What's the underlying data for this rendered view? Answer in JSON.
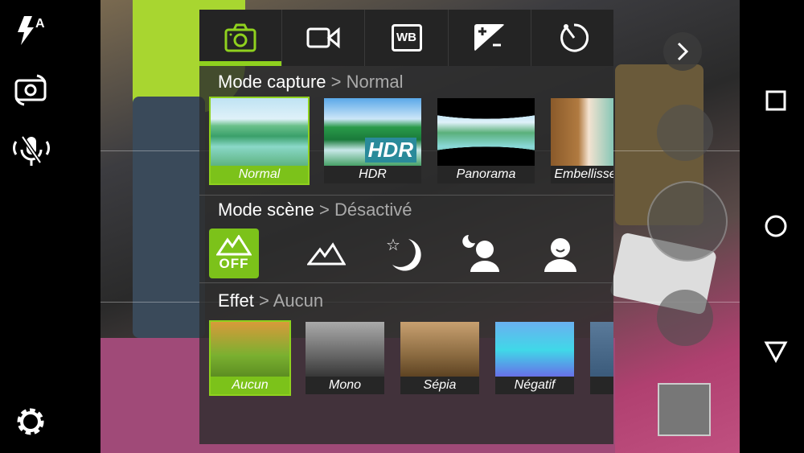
{
  "left_bar": {
    "flash_icon": "flash-auto-icon",
    "flash_badge": "A",
    "switch_icon": "switch-camera-icon",
    "mic_icon": "mic-off-icon",
    "settings_icon": "gear-icon"
  },
  "tabs": [
    {
      "icon": "camera-icon",
      "active": true
    },
    {
      "icon": "video-icon"
    },
    {
      "icon": "white-balance-icon",
      "label": "WB"
    },
    {
      "icon": "exposure-icon"
    },
    {
      "icon": "timer-icon"
    }
  ],
  "capture": {
    "title": "Mode capture",
    "value": "> Normal",
    "items": [
      {
        "label": "Normal",
        "selected": true
      },
      {
        "label": "HDR",
        "badge": "HDR"
      },
      {
        "label": "Panorama"
      },
      {
        "label": "Embellisse"
      }
    ]
  },
  "scene": {
    "title": "Mode scène",
    "value": "> Désactivé",
    "off_label": "OFF",
    "items": [
      "scene-off-icon",
      "landscape-icon",
      "night-icon",
      "night-portrait-icon",
      "portrait-icon"
    ]
  },
  "effect": {
    "title": "Effet",
    "value": "> Aucun",
    "items": [
      {
        "label": "Aucun",
        "selected": true
      },
      {
        "label": "Mono"
      },
      {
        "label": "Sépia"
      },
      {
        "label": "Négatif"
      },
      {
        "label": ""
      }
    ]
  },
  "accent": "#8fd11e",
  "right": {
    "expand_icon": "chevron-right-icon",
    "nav": [
      "square-icon",
      "circle-icon",
      "triangle-icon"
    ]
  }
}
